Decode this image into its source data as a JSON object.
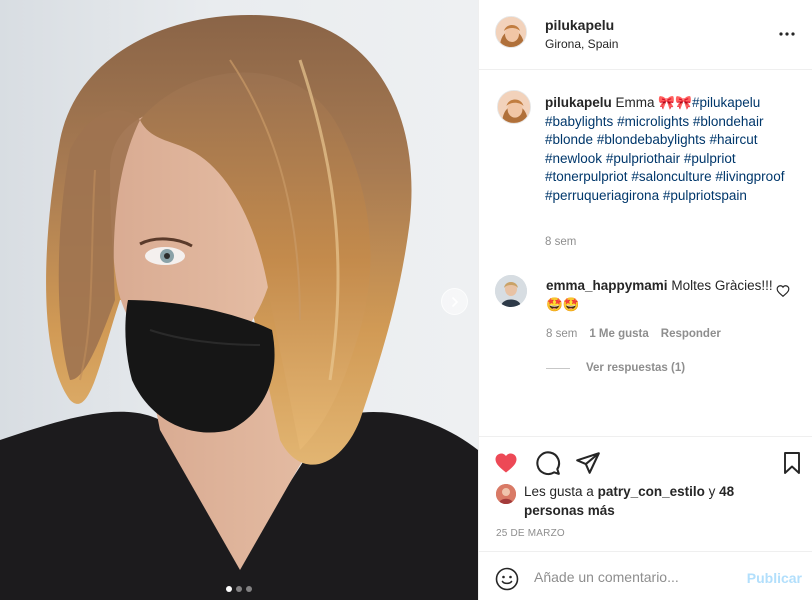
{
  "post": {
    "author": {
      "username": "pilukapelu",
      "location": "Girona, Spain"
    },
    "caption": {
      "username": "pilukapelu",
      "text_prefix": "Emma",
      "emoji": "🎀🎀",
      "hashtags": [
        "#pilukapelu",
        "#babylights",
        "#microlights",
        "#blondehair",
        "#blonde",
        "#blondebabylights",
        "#haircut",
        "#newlook",
        "#pulpriothair",
        "#pulpriot",
        "#tonerpulpriot",
        "#salonculture",
        "#livingproof",
        "#perruqueriagirona",
        "#pulpriotspain"
      ],
      "time": "8 sem"
    },
    "comments": [
      {
        "username": "emma_happymami",
        "text": "Moltes Gràcies!!!",
        "emoji": "🤩🤩",
        "time": "8 sem",
        "likes": "1 Me gusta",
        "reply_label": "Responder",
        "view_replies": "Ver respuestas (1)"
      }
    ],
    "likes": {
      "prefix": "Les gusta a",
      "liked_by": "patry_con_estilo",
      "conjunction": "y",
      "others": "48 personas más"
    },
    "date": "25 DE MARZO",
    "composer": {
      "placeholder": "Añade un comentario...",
      "publish_label": "Publicar"
    },
    "carousel": {
      "slide_count": 3,
      "active_slide": 1
    },
    "liked": true
  },
  "colors": {
    "link": "#00376b",
    "like_red": "#ed4956",
    "muted": "#8e8e8e",
    "publish_disabled": "#b2dffc",
    "border": "#efefef"
  },
  "icons": {
    "more": "more-horizontal-icon",
    "like": "heart-filled-icon",
    "comment": "comment-bubble-icon",
    "share": "paper-plane-icon",
    "save": "bookmark-icon",
    "comment_like": "heart-outline-icon",
    "emoji": "smiley-icon",
    "carousel_next": "chevron-right-icon"
  }
}
